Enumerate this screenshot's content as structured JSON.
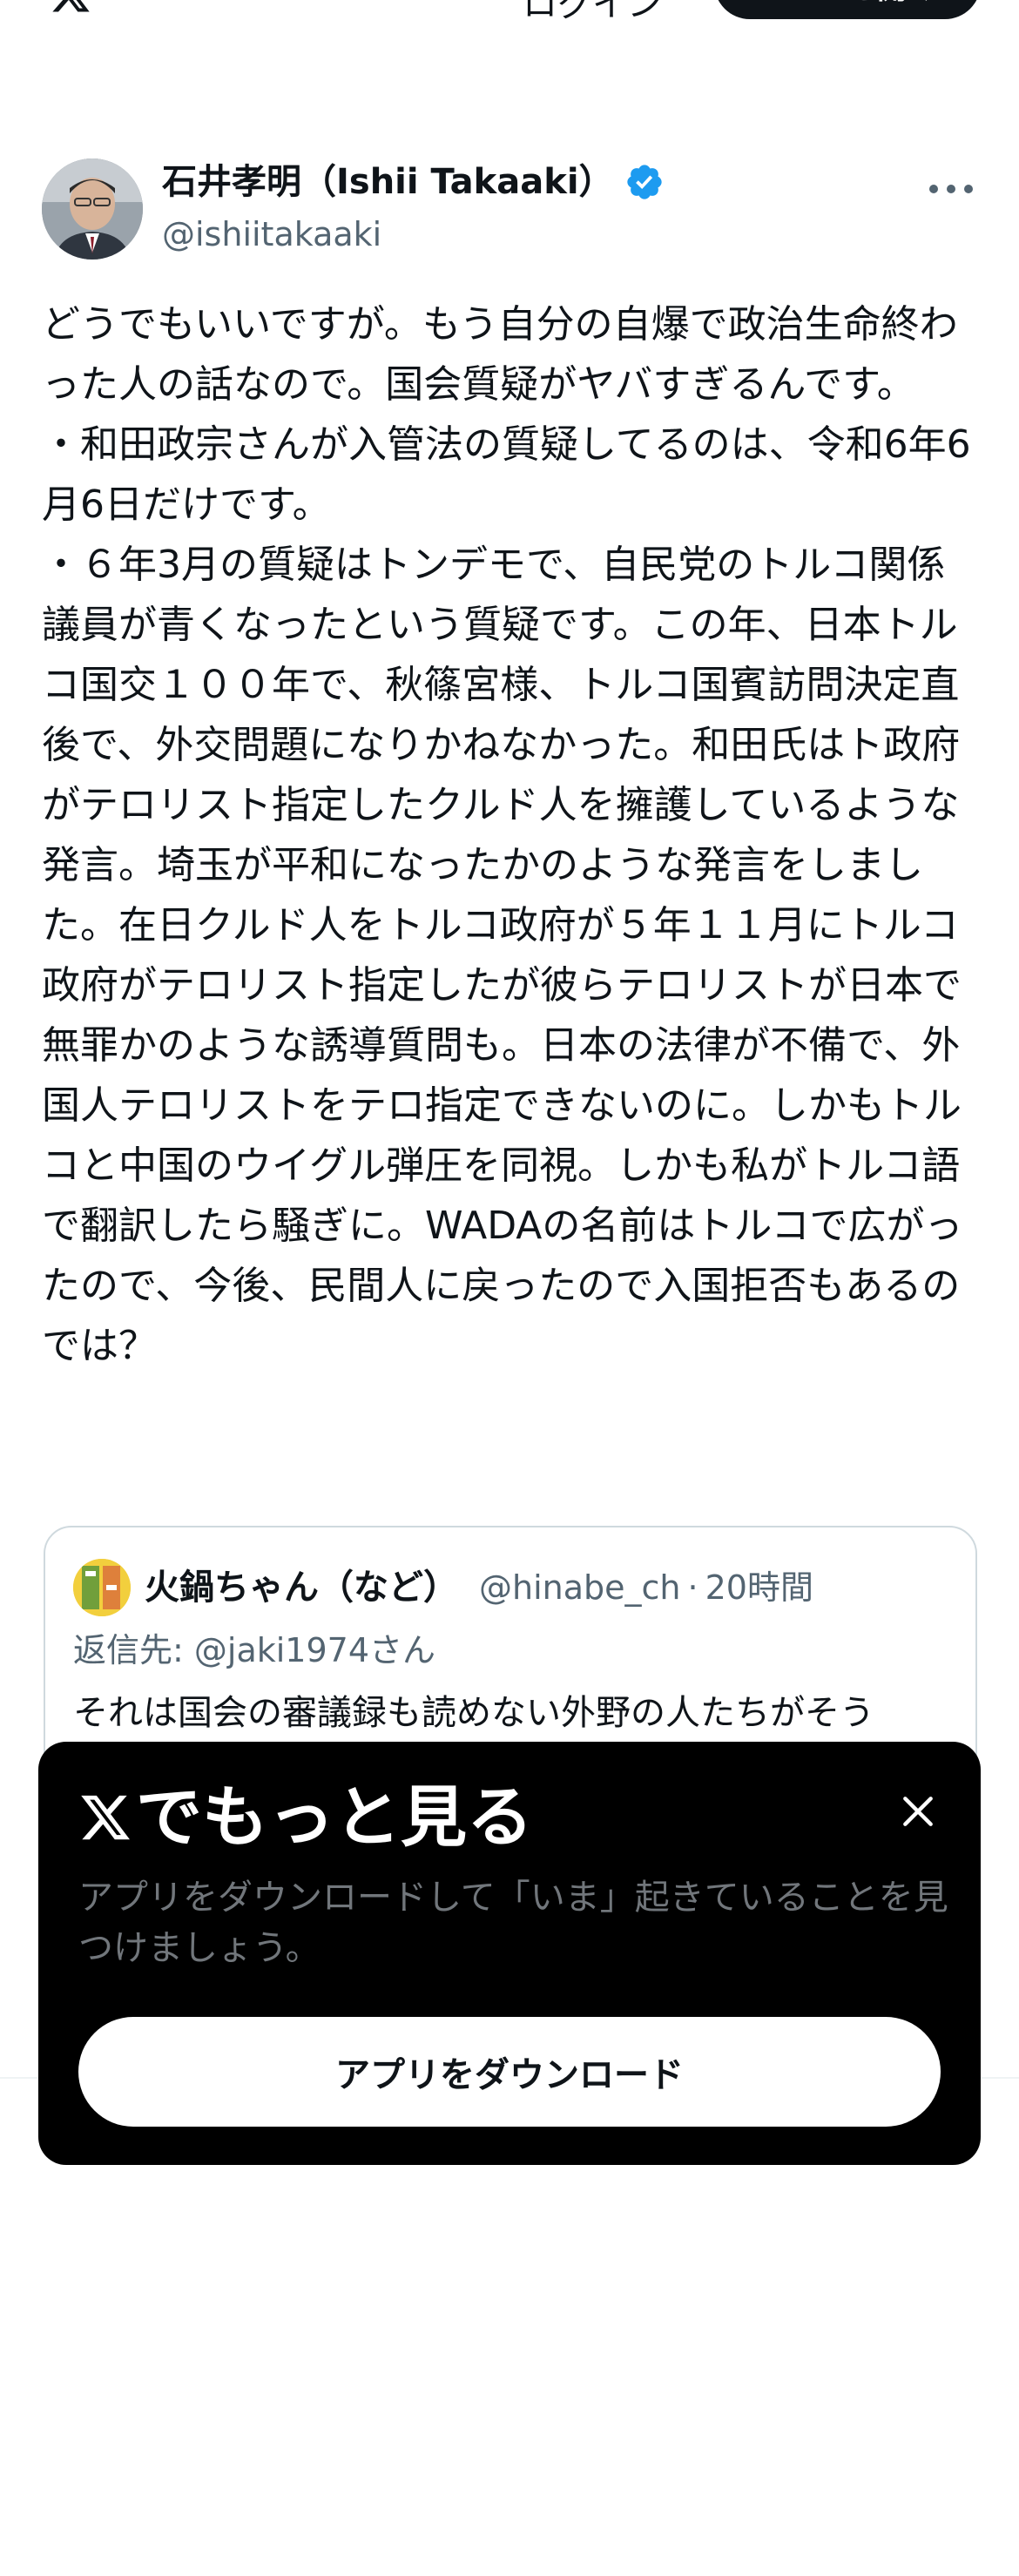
{
  "topbar": {
    "link_label": "ログイン",
    "button_label": "アプリを開く"
  },
  "author": {
    "name": "石井孝明（Ishii Takaaki）",
    "handle": "@ishiitakaaki",
    "verified_color": "#1d9bf0"
  },
  "tweet": {
    "text": "どうでもいいですが。もう自分の自爆で政治生命終わった人の話なので。国会質疑がヤバすぎるんです。\n・和田政宗さんが入管法の質疑してるのは、令和6年6月6日だけです。\n・６年3月の質疑はトンデモで、自民党のトルコ関係議員が青くなったという質疑です。この年、日本トルコ国交１００年で、秋篠宮様、トルコ国賓訪問決定直後で、外交問題になりかねなかった。和田氏はト政府がテロリスト指定したクルド人を擁護しているような発言。埼玉が平和になったかのような発言をしました。在日クルド人をトルコ政府が５年１１月にトルコ政府がテロリスト指定したが彼らテロリストが日本で無罪かのような誘導質問も。日本の法律が不備で、外国人テロリストをテロ指定できないのに。しかもトルコと中国のウイグル弾圧を同視。しかも私がトルコ語で翻訳したら騒ぎに。WADAの名前はトルコで広がったので、今後、民間人に戻ったので入国拒否もあるのでは？"
  },
  "quote": {
    "name": "火鍋ちゃん（など）",
    "handle": "@hinabe_ch",
    "dot": "·",
    "time": "20時間",
    "reply_prefix": "返信先: ",
    "reply_user": "@jaki1974さん",
    "text": "それは国会の審議録も読めない外野の人たちがそう"
  },
  "modal": {
    "title": "でもっと見る",
    "subtitle": "アプリをダウンロードして「いま」起きていることを見つけましょう。",
    "button_label": "アプリをダウンロード",
    "background": "#000000"
  }
}
